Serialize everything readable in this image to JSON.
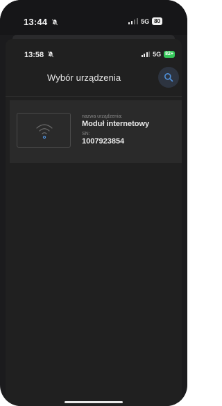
{
  "outer_status": {
    "time": "13:44",
    "network": "5G",
    "battery": "80"
  },
  "inner_status": {
    "time": "13:58",
    "network": "5G",
    "battery": "82+"
  },
  "header": {
    "title": "Wybór urządzenia",
    "search_icon": "search-icon"
  },
  "device": {
    "name_label": "nazwa urządzenia:",
    "name": "Moduł internetowy",
    "sn_label": "SN:",
    "sn": "1007923854",
    "icon": "wifi-icon"
  },
  "colors": {
    "accent": "#4f8fd8",
    "battery_green": "#34c759",
    "background": "#202020",
    "card": "#2a2a2a"
  }
}
